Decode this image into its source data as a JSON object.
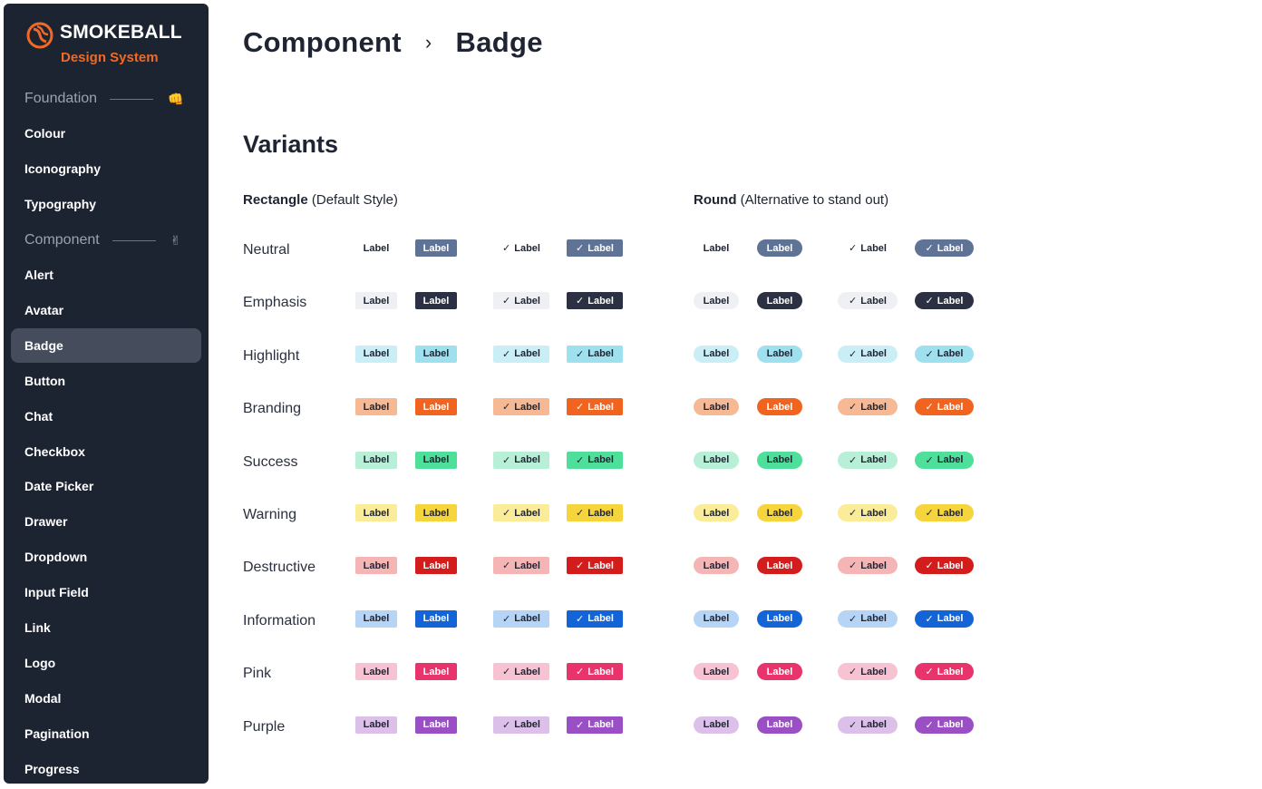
{
  "brand": {
    "name": "SMOKEBALL",
    "subtitle": "Design System",
    "accent_color": "#f06a25",
    "icon": "smokeball-logo-icon"
  },
  "sidebar": {
    "sections": [
      {
        "label": "Foundation",
        "emoji": "👊"
      },
      {
        "label": "Component",
        "emoji": "✌"
      }
    ],
    "foundation_items": [
      "Colour",
      "Iconography",
      "Typography"
    ],
    "component_items": [
      "Alert",
      "Avatar",
      "Badge",
      "Button",
      "Chat",
      "Checkbox",
      "Date Picker",
      "Drawer",
      "Dropdown",
      "Input Field",
      "Link",
      "Logo",
      "Modal",
      "Pagination",
      "Progress"
    ],
    "active_item": "Badge"
  },
  "breadcrumb": {
    "parent": "Component",
    "separator_icon": "chevron-right-icon",
    "current": "Badge"
  },
  "variants_title": "Variants",
  "columns": {
    "rectangle": {
      "bold": "Rectangle",
      "rest": " (Default Style)"
    },
    "round": {
      "bold": "Round",
      "rest": " (Alternative to stand out)"
    }
  },
  "badge_label": "Label",
  "check_icon": "check-icon",
  "rows": [
    {
      "name": "Neutral",
      "subtle_bg": "#ffffff",
      "subtle_fg": "#1f2433",
      "strong_bg": "#5f7396",
      "strong_fg": "#ffffff"
    },
    {
      "name": "Emphasis",
      "subtle_bg": "#eef0f3",
      "subtle_fg": "#1f2433",
      "strong_bg": "#2b3142",
      "strong_fg": "#ffffff"
    },
    {
      "name": "Highlight",
      "subtle_bg": "#c9eef6",
      "subtle_fg": "#1f2433",
      "strong_bg": "#9ee0ee",
      "strong_fg": "#1f2433"
    },
    {
      "name": "Branding",
      "subtle_bg": "#f7b993",
      "subtle_fg": "#1f2433",
      "strong_bg": "#f0641f",
      "strong_fg": "#ffffff"
    },
    {
      "name": "Success",
      "subtle_bg": "#b7f0d6",
      "subtle_fg": "#1f2433",
      "strong_bg": "#4ee09b",
      "strong_fg": "#1f2433"
    },
    {
      "name": "Warning",
      "subtle_bg": "#fbec9a",
      "subtle_fg": "#1f2433",
      "strong_bg": "#f5d53b",
      "strong_fg": "#1f2433"
    },
    {
      "name": "Destructive",
      "subtle_bg": "#f6b5b5",
      "subtle_fg": "#1f2433",
      "strong_bg": "#d31d1d",
      "strong_fg": "#ffffff"
    },
    {
      "name": "Information",
      "subtle_bg": "#b5d4f6",
      "subtle_fg": "#1f2433",
      "strong_bg": "#1364d6",
      "strong_fg": "#ffffff"
    },
    {
      "name": "Pink",
      "subtle_bg": "#f7c3d3",
      "subtle_fg": "#1f2433",
      "strong_bg": "#e8336c",
      "strong_fg": "#ffffff"
    },
    {
      "name": "Purple",
      "subtle_bg": "#dcc0ea",
      "subtle_fg": "#1f2433",
      "strong_bg": "#9b4fc4",
      "strong_fg": "#ffffff"
    }
  ]
}
